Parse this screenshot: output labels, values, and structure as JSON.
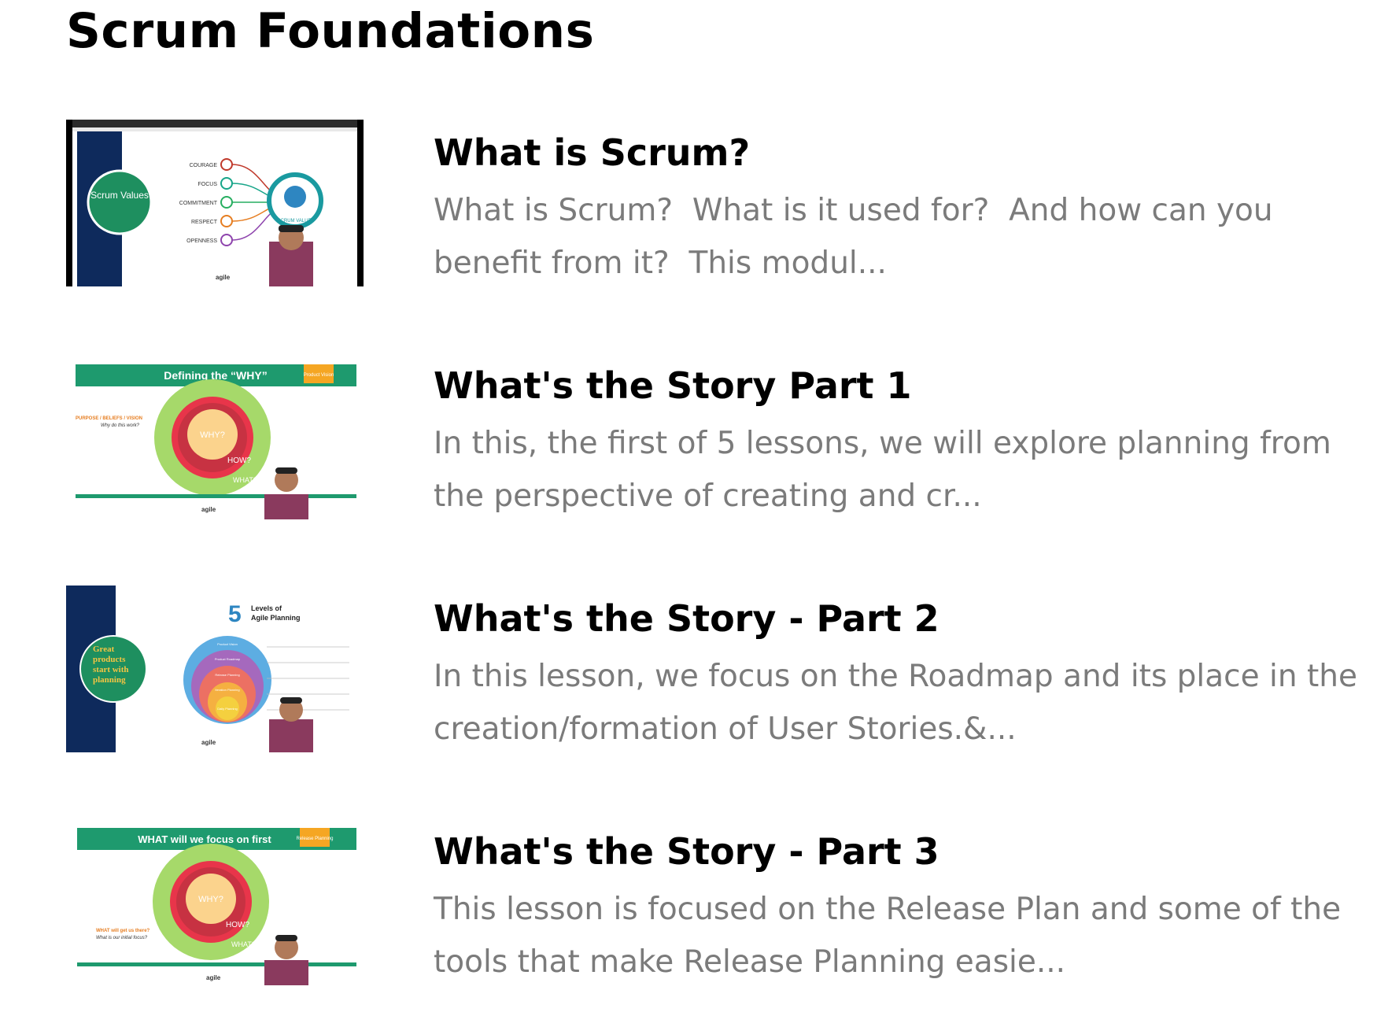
{
  "page": {
    "title": "Scrum Foundations"
  },
  "lessons": [
    {
      "title": "What is Scrum?",
      "description": "What is Scrum?  What is it used for?  And how can you benefit from it?  This modul...",
      "thumbnail": {
        "badge": "Scrum Values",
        "values": [
          "COURAGE",
          "FOCUS",
          "COMMITMENT",
          "RESPECT",
          "OPENNESS"
        ],
        "ring_label": "SCRUM VALUES",
        "logo": "agile"
      }
    },
    {
      "title": "What's the Story Part 1",
      "description": "In this, the first of 5 lessons, we will explore planning from the perspective of creating and cr...",
      "thumbnail": {
        "header": "Defining the “WHY”",
        "tag": "Product Vision",
        "side_label": "PURPOSE / BELIEFS / VISION",
        "side_sub": "Why do this work?",
        "rings": [
          "WHY?",
          "HOW?",
          "WHAT?"
        ],
        "logo": "agile"
      }
    },
    {
      "title": "What's the Story - Part 2",
      "description": "In this lesson, we focus on the Roadmap and its place in the creation/formation of User Stories.&...",
      "thumbnail": {
        "badge_lines": [
          "Great",
          "products",
          "start with",
          "planning"
        ],
        "number": "5",
        "heading_lines": [
          "Levels of",
          "Agile Planning"
        ],
        "levels": [
          "Product Vision",
          "Product Roadmap",
          "Release Planning",
          "Iteration Planning",
          "Daily Planning"
        ],
        "logo": "agile"
      }
    },
    {
      "title": "What's the Story - Part 3",
      "description": "This lesson is focused on the Release Plan and some of the tools that make Release Planning easie...",
      "thumbnail": {
        "header": "WHAT will we focus on first",
        "tag": "Release Planning",
        "side_label": "WHAT will get us there?",
        "side_sub": "What is our initial focus?",
        "rings": [
          "WHY?",
          "HOW?",
          "WHAT?"
        ],
        "logo": "agile"
      }
    }
  ]
}
